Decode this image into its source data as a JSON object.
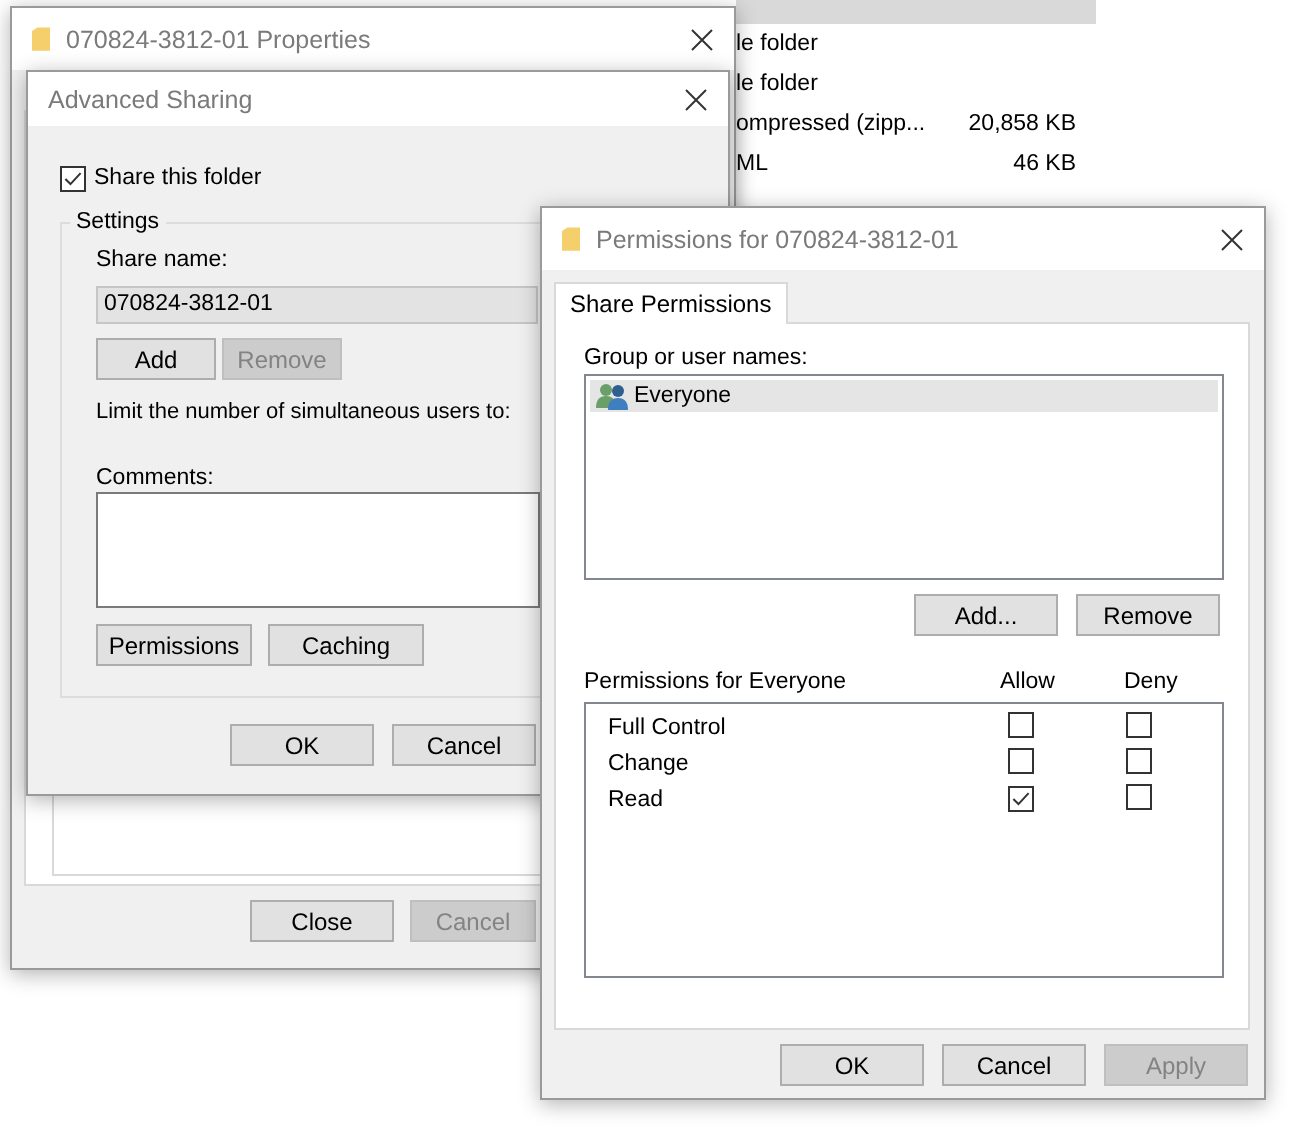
{
  "explorer": {
    "rows": [
      {
        "selected": true
      },
      {
        "type": "le folder",
        "selected": false
      },
      {
        "type": "le folder",
        "selected": false
      },
      {
        "type": "ompressed (zipp...",
        "size": "20,858 KB",
        "selected": false
      },
      {
        "type": "ML",
        "size": "46 KB",
        "selected": false
      }
    ]
  },
  "properties": {
    "title": "070824-3812-01 Properties",
    "buttons": [
      {
        "label": "Close",
        "disabled": false
      },
      {
        "label": "Cancel",
        "disabled": true
      }
    ]
  },
  "advanced_sharing": {
    "title": "Advanced Sharing",
    "share_checkbox": {
      "label": "Share this folder",
      "checked": true
    },
    "settings": {
      "legend": "Settings",
      "share_name_label": "Share name:",
      "share_name": "070824-3812-01",
      "name_buttons": [
        {
          "label": "Add",
          "disabled": false
        },
        {
          "label": "Remove",
          "disabled": true
        }
      ],
      "limit_label": "Limit the number of simultaneous users to:",
      "comments_label": "Comments:",
      "buttons": [
        {
          "label": "Permissions",
          "disabled": false
        },
        {
          "label": "Caching",
          "disabled": false
        }
      ]
    },
    "buttons": [
      {
        "label": "OK",
        "disabled": false
      },
      {
        "label": "Cancel",
        "disabled": false
      }
    ]
  },
  "permissions": {
    "title": "Permissions for 070824-3812-01",
    "tabs": [
      {
        "label": "Share Permissions",
        "selected": true
      }
    ],
    "users_label": "Group or user names:",
    "users": [
      {
        "name": "Everyone",
        "selected": true
      }
    ],
    "user_buttons": [
      {
        "label": "Add...",
        "disabled": false
      },
      {
        "label": "Remove",
        "disabled": false
      }
    ],
    "table_label": "Permissions for Everyone",
    "allow_label": "Allow",
    "deny_label": "Deny",
    "rows": [
      {
        "name": "Full Control",
        "allow": false,
        "deny": false
      },
      {
        "name": "Change",
        "allow": false,
        "deny": false
      },
      {
        "name": "Read",
        "allow": true,
        "deny": false
      }
    ],
    "buttons": [
      {
        "label": "OK",
        "disabled": false
      },
      {
        "label": "Cancel",
        "disabled": false
      },
      {
        "label": "Apply",
        "disabled": true
      }
    ]
  }
}
